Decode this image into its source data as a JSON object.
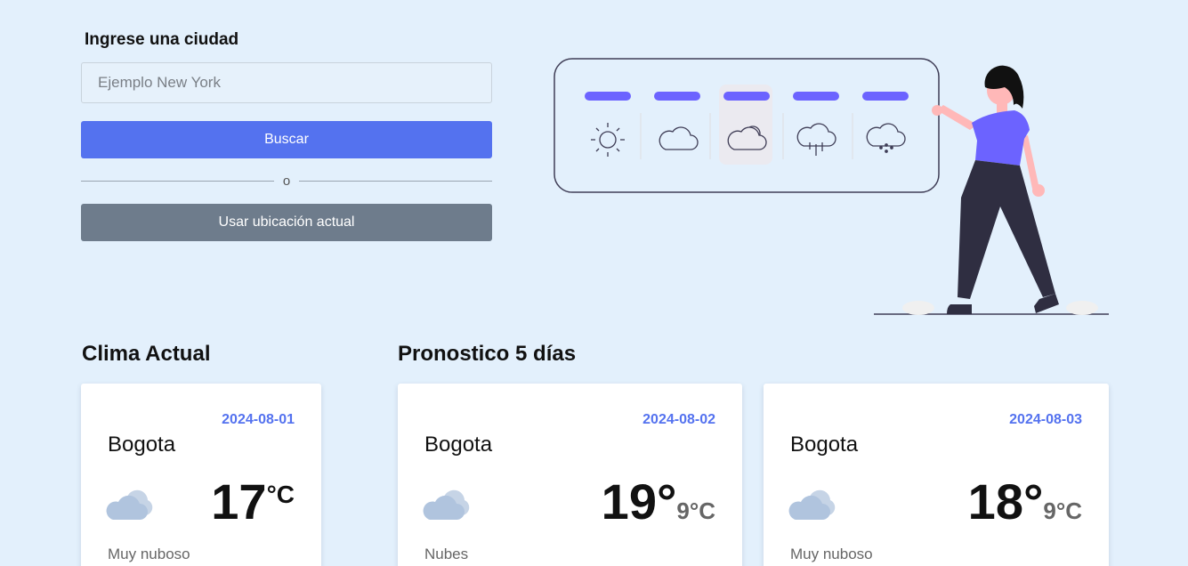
{
  "search": {
    "label": "Ingrese una ciudad",
    "placeholder": "Ejemplo New York",
    "value": "",
    "search_button": "Buscar",
    "divider_text": "o",
    "location_button": "Usar ubicación actual"
  },
  "illustration": {
    "weather_icons": [
      "sun-icon",
      "cloud-icon",
      "partly-cloudy-icon",
      "rain-icon",
      "snow-icon"
    ],
    "accent_color": "#6c63ff"
  },
  "sections": {
    "current_title": "Clima Actual",
    "forecast_title": "Pronostico 5 días"
  },
  "current": {
    "date": "2024-08-01",
    "city": "Bogota",
    "temp": "17",
    "unit": "°C",
    "icon": "cloud-icon",
    "description": "Muy nuboso"
  },
  "forecast": [
    {
      "date": "2024-08-02",
      "city": "Bogota",
      "temp_max": "19°",
      "temp_min": "9°C",
      "icon": "cloud-icon",
      "description": "Nubes"
    },
    {
      "date": "2024-08-03",
      "city": "Bogota",
      "temp_max": "18°",
      "temp_min": "9°C",
      "icon": "cloud-icon",
      "description": "Muy nuboso"
    }
  ],
  "colors": {
    "background": "#e3f0fc",
    "primary": "#5472ef",
    "secondary_button": "#6e7c8c",
    "cloud": "#b0c4de"
  }
}
